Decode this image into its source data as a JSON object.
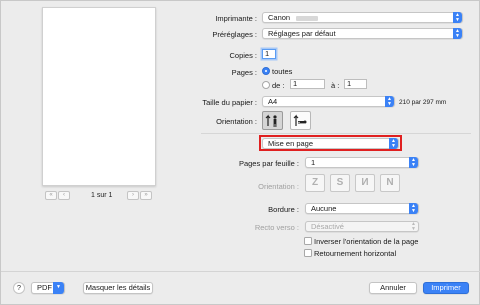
{
  "preview": {
    "page_indicator": "1 sur 1",
    "nav": {
      "first": "«",
      "prev": "‹",
      "next": "›",
      "last": "»"
    }
  },
  "printer": {
    "label": "Imprimante :",
    "value": "Canon"
  },
  "presets": {
    "label": "Préréglages :",
    "value": "Réglages par défaut"
  },
  "copies": {
    "label": "Copies :",
    "value": "1"
  },
  "pages": {
    "label": "Pages :",
    "all_label": "toutes",
    "from_label": "de :",
    "from_value": "1",
    "to_label": "à :",
    "to_value": "1",
    "selected": "all"
  },
  "paper_size": {
    "label": "Taille du papier :",
    "value": "A4",
    "dimensions": "210 par 297 mm"
  },
  "orientation": {
    "label": "Orientation :",
    "selected": "portrait"
  },
  "section": {
    "value": "Mise en page"
  },
  "layout": {
    "pages_per_sheet_label": "Pages par feuille :",
    "pages_per_sheet_value": "1",
    "orientation_label": "Orientation :",
    "border_label": "Bordure :",
    "border_value": "Aucune",
    "duplex_label": "Recto verso :",
    "duplex_value": "Désactivé",
    "reverse_label": "Inverser l'orientation de la page",
    "flip_label": "Retournement horizontal"
  },
  "footer": {
    "help": "?",
    "pdf": "PDF",
    "hide_details": "Masquer les détails",
    "cancel": "Annuler",
    "print": "Imprimer"
  },
  "colors": {
    "accent": "#3b82f6",
    "highlight": "#e02020"
  }
}
